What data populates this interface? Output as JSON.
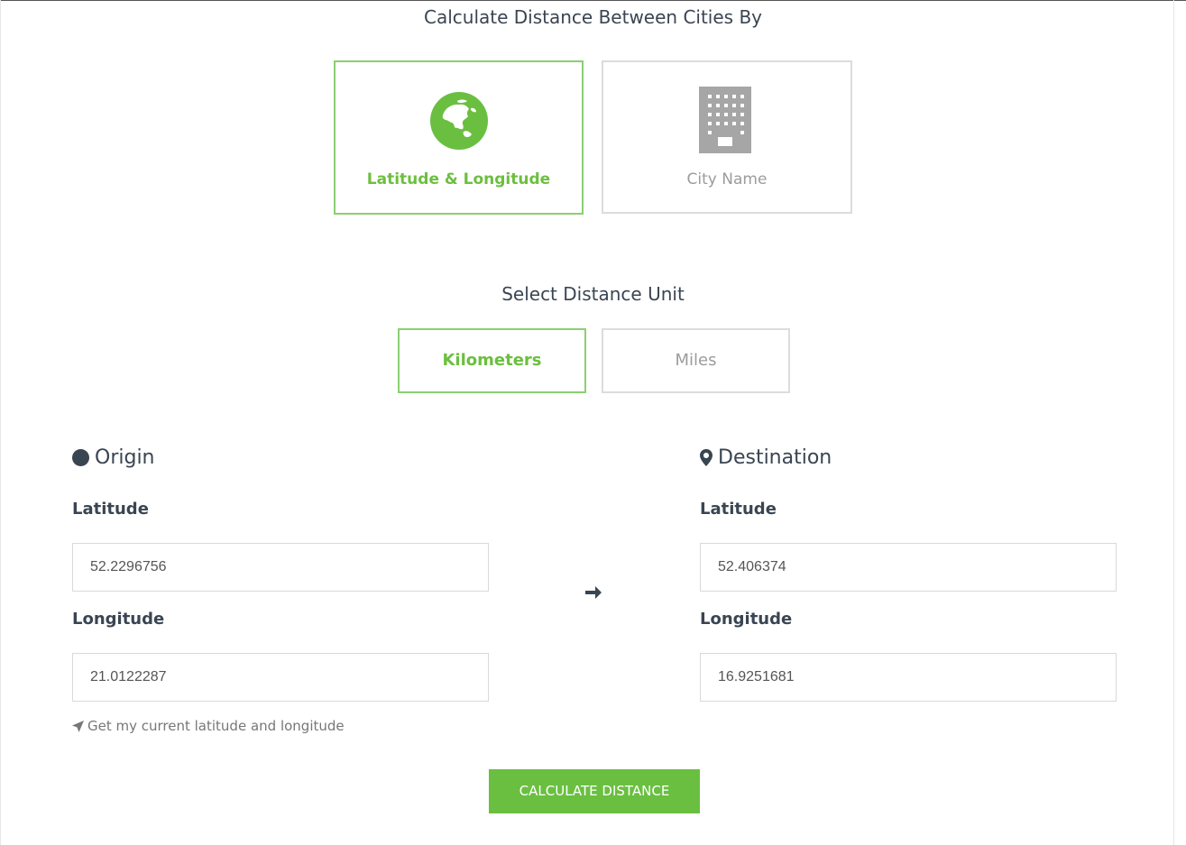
{
  "header": {
    "title": "Calculate Distance Between Cities By"
  },
  "methods": [
    {
      "label": "Latitude & Longitude",
      "icon": "globe-icon",
      "selected": true
    },
    {
      "label": "City Name",
      "icon": "building-icon",
      "selected": false
    }
  ],
  "unit_section": {
    "title": "Select Distance Unit",
    "options": [
      {
        "label": "Kilometers",
        "selected": true
      },
      {
        "label": "Miles",
        "selected": false
      }
    ]
  },
  "origin": {
    "heading": "Origin",
    "icon": "circle-icon",
    "latitude_label": "Latitude",
    "latitude_value": "52.2296756",
    "longitude_label": "Longitude",
    "longitude_value": "21.0122287"
  },
  "destination": {
    "heading": "Destination",
    "icon": "map-marker-icon",
    "latitude_label": "Latitude",
    "latitude_value": "52.406374",
    "longitude_label": "Longitude",
    "longitude_value": "16.9251681"
  },
  "geo_link": {
    "label": "Get my current latitude and longitude",
    "icon": "location-arrow-icon"
  },
  "action": {
    "label": "CALCULATE DISTANCE"
  },
  "colors": {
    "accent": "#6abf40",
    "text": "#3a4552",
    "muted": "#9c9c9c",
    "border": "#dcdcdc"
  }
}
